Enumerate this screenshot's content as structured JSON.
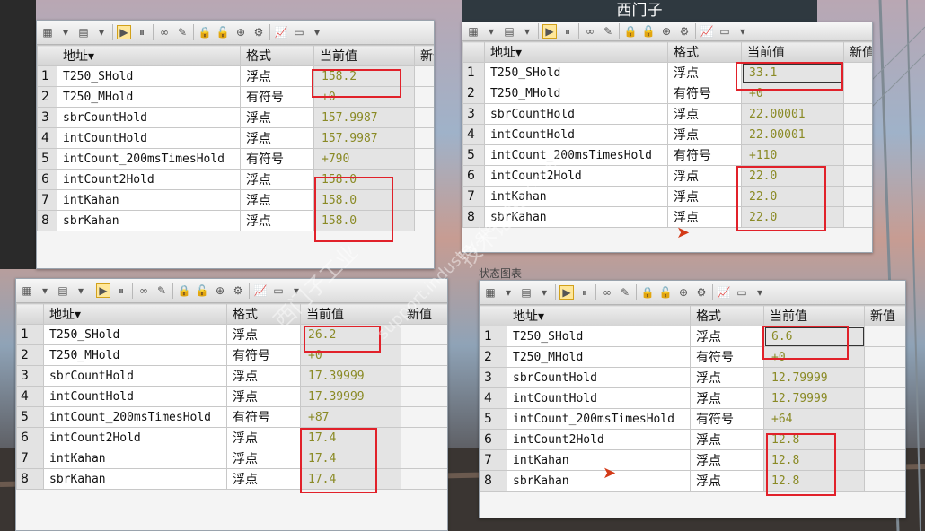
{
  "caption": "西门子",
  "toolbar_label": "状态图表",
  "watermark_lines": [
    "西门子工业",
    "support.industry.siemens.com/cs",
    "技术论坛"
  ],
  "headers": {
    "addr": "地址",
    "fmt": "格式",
    "val": "当前值",
    "new": "新值"
  },
  "panels": [
    {
      "rows": [
        {
          "num": "1",
          "addr": "T250_SHold",
          "fmt": "浮点",
          "val": "158.2"
        },
        {
          "num": "2",
          "addr": "T250_MHold",
          "fmt": "有符号",
          "val": "+0"
        },
        {
          "num": "3",
          "addr": "sbrCountHold",
          "fmt": "浮点",
          "val": "157.9987"
        },
        {
          "num": "4",
          "addr": "intCountHold",
          "fmt": "浮点",
          "val": "157.9987"
        },
        {
          "num": "5",
          "addr": "intCount_200msTimesHold",
          "fmt": "有符号",
          "val": "+790"
        },
        {
          "num": "6",
          "addr": "intCount2Hold",
          "fmt": "浮点",
          "val": "158.0"
        },
        {
          "num": "7",
          "addr": "intKahan",
          "fmt": "浮点",
          "val": "158.0"
        },
        {
          "num": "8",
          "addr": "sbrKahan",
          "fmt": "浮点",
          "val": "158.0"
        }
      ]
    },
    {
      "rows": [
        {
          "num": "1",
          "addr": "T250_SHold",
          "fmt": "浮点",
          "val": "33.1"
        },
        {
          "num": "2",
          "addr": "T250_MHold",
          "fmt": "有符号",
          "val": "+0"
        },
        {
          "num": "3",
          "addr": "sbrCountHold",
          "fmt": "浮点",
          "val": "22.00001"
        },
        {
          "num": "4",
          "addr": "intCountHold",
          "fmt": "浮点",
          "val": "22.00001"
        },
        {
          "num": "5",
          "addr": "intCount_200msTimesHold",
          "fmt": "有符号",
          "val": "+110"
        },
        {
          "num": "6",
          "addr": "intCount2Hold",
          "fmt": "浮点",
          "val": "22.0"
        },
        {
          "num": "7",
          "addr": "intKahan",
          "fmt": "浮点",
          "val": "22.0"
        },
        {
          "num": "8",
          "addr": "sbrKahan",
          "fmt": "浮点",
          "val": "22.0"
        }
      ]
    },
    {
      "rows": [
        {
          "num": "1",
          "addr": "T250_SHold",
          "fmt": "浮点",
          "val": "26.2"
        },
        {
          "num": "2",
          "addr": "T250_MHold",
          "fmt": "有符号",
          "val": "+0"
        },
        {
          "num": "3",
          "addr": "sbrCountHold",
          "fmt": "浮点",
          "val": "17.39999"
        },
        {
          "num": "4",
          "addr": "intCountHold",
          "fmt": "浮点",
          "val": "17.39999"
        },
        {
          "num": "5",
          "addr": "intCount_200msTimesHold",
          "fmt": "有符号",
          "val": "+87"
        },
        {
          "num": "6",
          "addr": "intCount2Hold",
          "fmt": "浮点",
          "val": "17.4"
        },
        {
          "num": "7",
          "addr": "intKahan",
          "fmt": "浮点",
          "val": "17.4"
        },
        {
          "num": "8",
          "addr": "sbrKahan",
          "fmt": "浮点",
          "val": "17.4"
        }
      ]
    },
    {
      "rows": [
        {
          "num": "1",
          "addr": "T250_SHold",
          "fmt": "浮点",
          "val": "6.6"
        },
        {
          "num": "2",
          "addr": "T250_MHold",
          "fmt": "有符号",
          "val": "+0"
        },
        {
          "num": "3",
          "addr": "sbrCountHold",
          "fmt": "浮点",
          "val": "12.79999"
        },
        {
          "num": "4",
          "addr": "intCountHold",
          "fmt": "浮点",
          "val": "12.79999"
        },
        {
          "num": "5",
          "addr": "intCount_200msTimesHold",
          "fmt": "有符号",
          "val": "+64"
        },
        {
          "num": "6",
          "addr": "intCount2Hold",
          "fmt": "浮点",
          "val": "12.8"
        },
        {
          "num": "7",
          "addr": "intKahan",
          "fmt": "浮点",
          "val": "12.8"
        },
        {
          "num": "8",
          "addr": "sbrKahan",
          "fmt": "浮点",
          "val": "12.8"
        }
      ]
    }
  ],
  "colors": {
    "highlight": "#e1212a",
    "value_text": "#8a8a25"
  }
}
